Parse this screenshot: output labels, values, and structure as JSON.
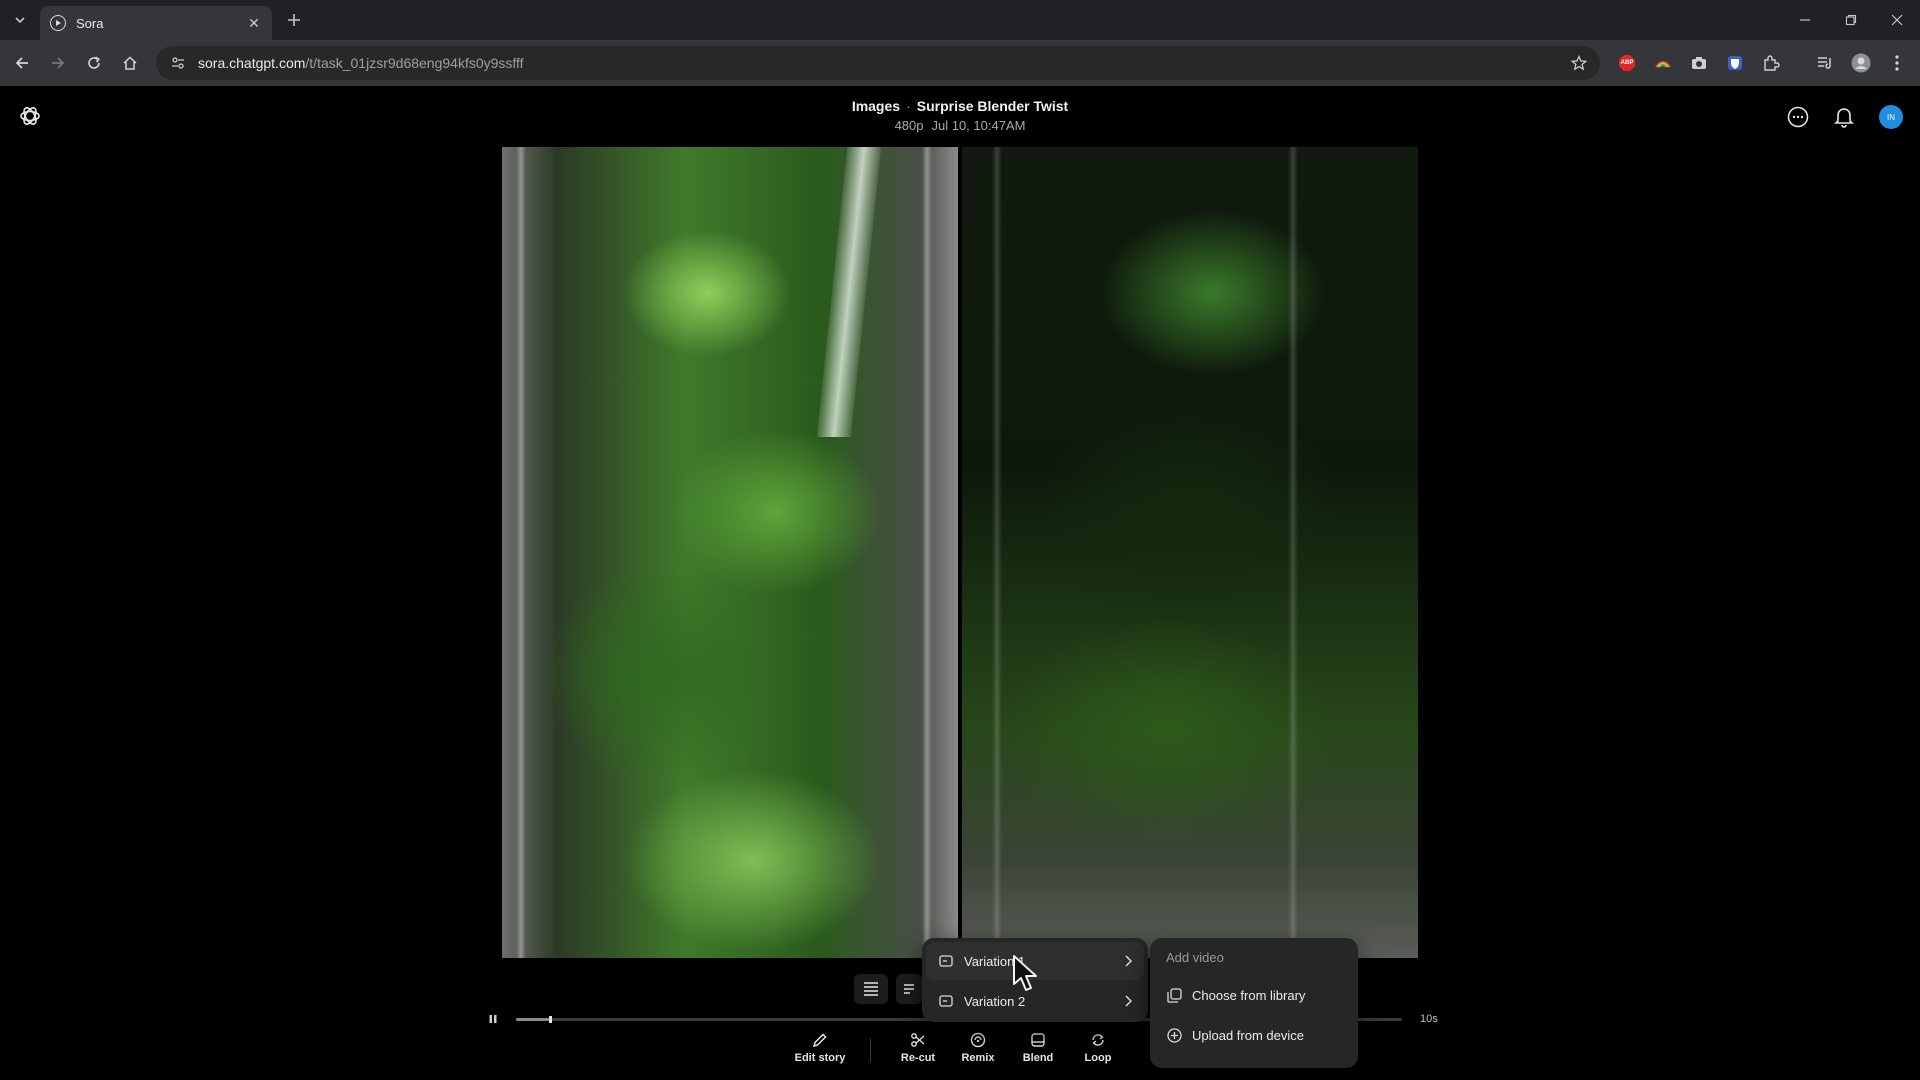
{
  "browser": {
    "tab_title": "Sora",
    "url_host": "sora.chatgpt.com",
    "url_path": "/t/task_01jzsr9d68eng94kfs0y9ssfff",
    "ext_abp_label": "ABP"
  },
  "header": {
    "section": "Images",
    "separator": "·",
    "title": "Surprise Blender Twist",
    "resolution": "480p",
    "timestamp": "Jul 10, 10:47AM",
    "avatar_initials": "IN"
  },
  "player": {
    "duration": "10s",
    "progress_fraction": 0.037
  },
  "actions": [
    {
      "label": "Edit story"
    },
    {
      "label": "Re-cut"
    },
    {
      "label": "Remix"
    },
    {
      "label": "Blend"
    },
    {
      "label": "Loop"
    }
  ],
  "variation_menu": {
    "items": [
      {
        "label": "Variation 1"
      },
      {
        "label": "Variation 2"
      }
    ]
  },
  "add_menu": {
    "header": "Add video",
    "items": [
      {
        "label": "Choose from library"
      },
      {
        "label": "Upload from device"
      }
    ]
  },
  "colors": {
    "background": "#000000",
    "menu_bg": "#262626",
    "avatar": "#1f8de0",
    "chrome_toolbar": "#35363a"
  }
}
